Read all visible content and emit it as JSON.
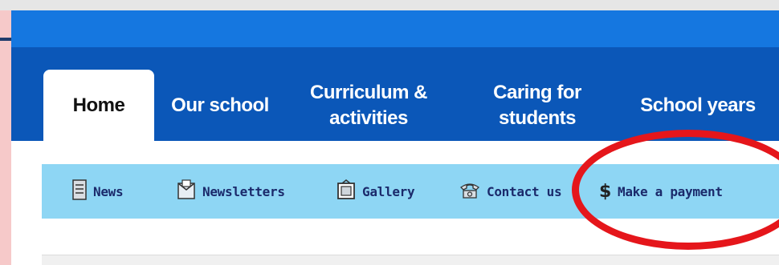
{
  "nav": {
    "tabs": [
      {
        "label": "Home",
        "active": true
      },
      {
        "label": "Our school"
      },
      {
        "label": "Curriculum &\nactivities"
      },
      {
        "label": "Caring for\nstudents"
      },
      {
        "label": "School years"
      }
    ]
  },
  "subnav": {
    "items": [
      {
        "label": "News",
        "icon": "news-icon"
      },
      {
        "label": "Newsletters",
        "icon": "newsletter-icon"
      },
      {
        "label": "Gallery",
        "icon": "gallery-icon"
      },
      {
        "label": "Contact us",
        "icon": "phone-icon"
      },
      {
        "label": "Make a payment",
        "icon": "dollar-icon"
      }
    ]
  },
  "colors": {
    "brand_blue": "#1577e0",
    "nav_blue": "#0b57b8",
    "subnav_bg": "#8ed6f4",
    "highlight_red": "#e5161b"
  }
}
